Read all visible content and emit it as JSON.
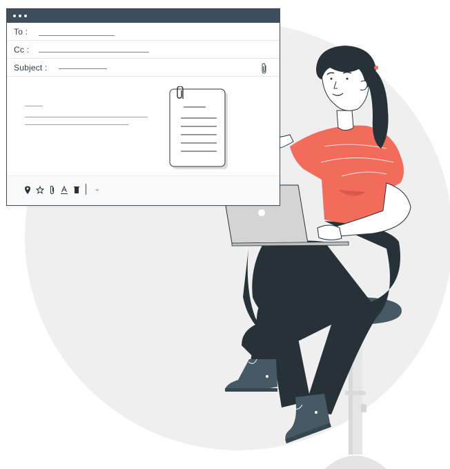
{
  "compose_window": {
    "to_label": "To :",
    "cc_label": "Cc :",
    "subject_label": "Subject :"
  },
  "icons": {
    "attach": "paperclip-icon",
    "location": "location-pin-icon",
    "favorite": "star-icon",
    "attach_toolbar": "paperclip-icon",
    "text_format": "text-format-icon",
    "delete": "trash-icon",
    "more": "chevron-down-icon"
  },
  "colors": {
    "shirt": "#f26b5b",
    "pants": "#263238",
    "dark_slate": "#3f4e5c",
    "circle_bg": "#efefef",
    "laptop": "#cfcfcf"
  }
}
